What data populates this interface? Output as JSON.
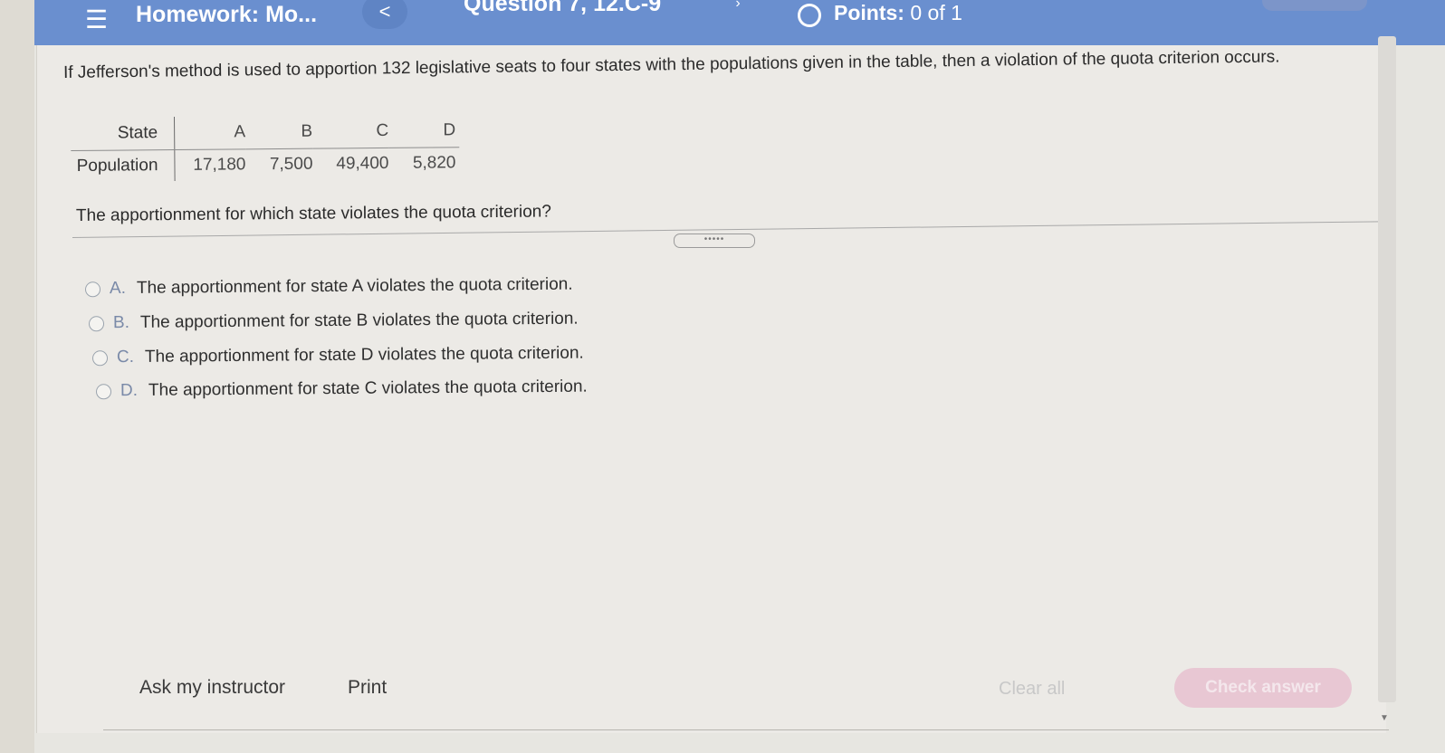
{
  "header": {
    "menu_icon": "hamburger-menu-icon",
    "homework_title": "Homework: Mo...",
    "prev_label": "<",
    "question_title": "Question 7, 12.C-9",
    "next_label": "›",
    "points_label": "Points:",
    "points_value": "0 of 1"
  },
  "question": {
    "text": "If Jefferson's method is used to apportion 132 legislative seats to four states with the populations given in the table, then a violation of the quota criterion occurs.",
    "table": {
      "row_headers": [
        "State",
        "Population"
      ],
      "states": [
        "A",
        "B",
        "C",
        "D"
      ],
      "populations": [
        "17,180",
        "7,500",
        "49,400",
        "5,820"
      ]
    },
    "prompt": "The apportionment for which state violates the quota criterion?",
    "expand_handle": "•••••"
  },
  "options": [
    {
      "letter": "A.",
      "text": "The apportionment for state A violates the quota criterion."
    },
    {
      "letter": "B.",
      "text": "The apportionment for state B violates the quota criterion."
    },
    {
      "letter": "C.",
      "text": "The apportionment for state D violates the quota criterion."
    },
    {
      "letter": "D.",
      "text": "The apportionment for state C violates the quota criterion."
    }
  ],
  "footer": {
    "ask_instructor": "Ask my instructor",
    "print": "Print",
    "clear_all": "Clear all",
    "check_answer": "Check answer"
  },
  "colors": {
    "header_bg": "#6a8fcf",
    "check_button": "#e8c7d3"
  }
}
